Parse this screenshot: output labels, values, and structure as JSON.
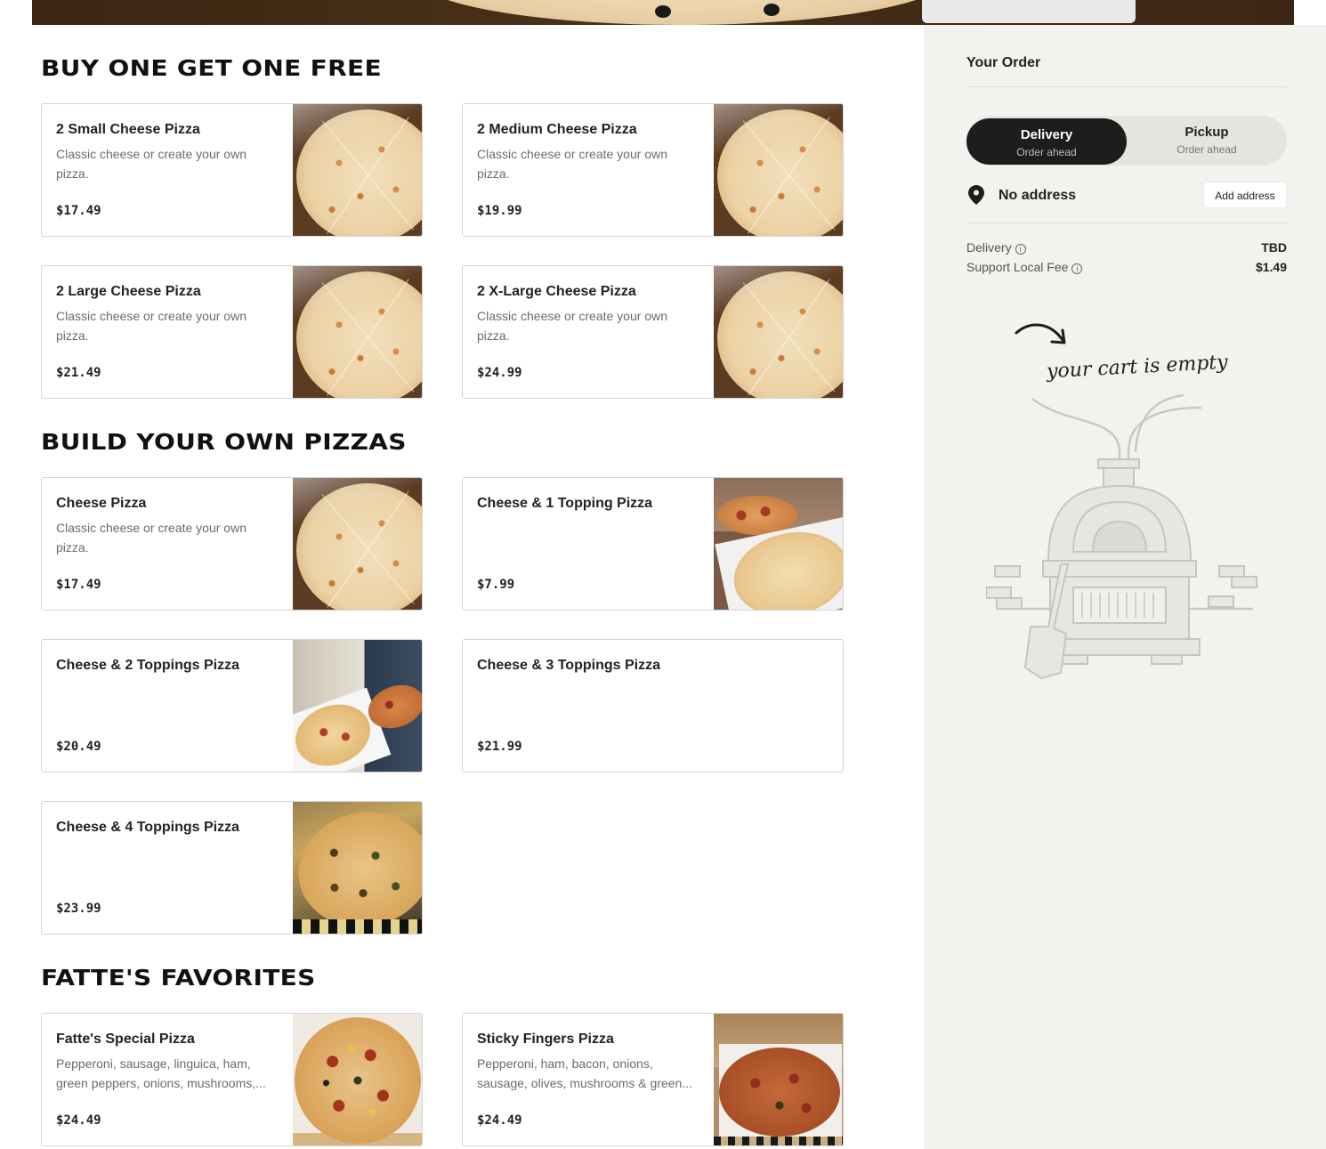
{
  "sections": [
    {
      "title": "BUY ONE GET ONE FREE",
      "items": [
        {
          "name": "2 Small Cheese Pizza",
          "desc": "Classic cheese or create your own pizza.",
          "price": "$17.49"
        },
        {
          "name": "2 Medium Cheese Pizza",
          "desc": "Classic cheese or create your own pizza.",
          "price": "$19.99"
        },
        {
          "name": "2 Large Cheese Pizza",
          "desc": "Classic cheese or create your own pizza.",
          "price": "$21.49"
        },
        {
          "name": "2 X-Large Cheese Pizza",
          "desc": "Classic cheese or create your own pizza.",
          "price": "$24.99"
        }
      ]
    },
    {
      "title": "BUILD YOUR OWN PIZZAS",
      "items": [
        {
          "name": "Cheese Pizza",
          "desc": "Classic cheese or create your own pizza.",
          "price": "$17.49"
        },
        {
          "name": "Cheese & 1 Topping Pizza",
          "desc": "",
          "price": "$7.99"
        },
        {
          "name": "Cheese & 2 Toppings Pizza",
          "desc": "",
          "price": "$20.49"
        },
        {
          "name": "Cheese & 3 Toppings Pizza",
          "desc": "",
          "price": "$21.99"
        },
        {
          "name": "Cheese & 4 Toppings Pizza",
          "desc": "",
          "price": "$23.99"
        }
      ]
    },
    {
      "title": "FATTE'S FAVORITES",
      "items": [
        {
          "name": "Fatte's Special Pizza",
          "desc": "Pepperoni, sausage, linguica, ham, green peppers, onions, mushrooms,...",
          "price": "$24.49"
        },
        {
          "name": "Sticky Fingers Pizza",
          "desc": "Pepperoni, ham, bacon, onions, sausage, olives, mushrooms & green...",
          "price": "$24.49"
        }
      ]
    }
  ],
  "order": {
    "title": "Your Order",
    "delivery_option": {
      "label": "Delivery",
      "sub": "Order ahead"
    },
    "pickup_option": {
      "label": "Pickup",
      "sub": "Order ahead"
    },
    "address_label": "No address",
    "add_address": "Add address",
    "fees": [
      {
        "label": "Delivery",
        "value": "TBD"
      },
      {
        "label": "Support Local Fee",
        "value": "$1.49"
      }
    ],
    "empty_message": "your cart is empty"
  },
  "icons": {
    "pin": "location-pin-icon",
    "info": "info-icon",
    "arrow": "curved-arrow-icon",
    "oven": "pizza-oven-illustration"
  }
}
